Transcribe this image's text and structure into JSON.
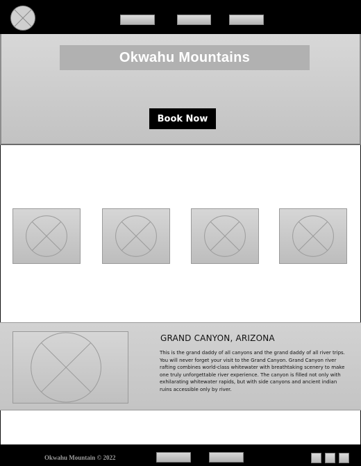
{
  "header": {
    "logo_icon": "placeholder-image-icon",
    "nav": [
      "",
      "",
      ""
    ]
  },
  "hero": {
    "title": "Okwahu Mountains",
    "cta_label": "Book Now"
  },
  "gallery": {
    "thumbnail_icon": "placeholder-image-icon",
    "count": 4
  },
  "feature": {
    "title": "GRAND CANYON, ARIZONA",
    "body": "This is the grand daddy of all canyons and the grand daddy of all river trips. You will never forget your visit to the Grand Canyon. Grand Canyon river rafting combines world-class whitewater with breathtaking scenery to make one truly unforgettable river experience. The canyon is filled not only with exhilarating whitewater rapids, but with side canyons and ancient indian ruins accessible only by river."
  },
  "footer": {
    "copyright": "Okwahu Mountain © 2022",
    "links": [
      "",
      ""
    ],
    "social_icons": [
      "social-icon",
      "social-icon",
      "social-icon"
    ]
  },
  "colors": {
    "header_bg": "#000000",
    "placeholder_gray": "#c8c8c8",
    "cta_bg": "#000000",
    "cta_text": "#ffffff"
  }
}
